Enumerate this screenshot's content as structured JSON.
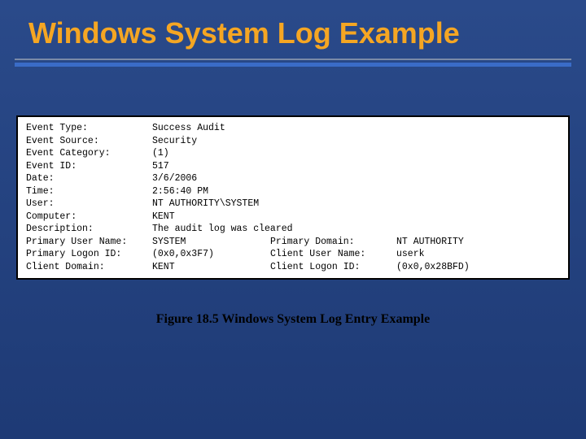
{
  "title": "Windows System Log Example",
  "log": {
    "rows": [
      {
        "label": "Event Type:",
        "value": "Success Audit"
      },
      {
        "label": "Event Source:",
        "value": "Security"
      },
      {
        "label": "Event Category:",
        "value": "(1)"
      },
      {
        "label": "Event ID:",
        "value": "517"
      },
      {
        "label": "Date:",
        "value": "3/6/2006"
      },
      {
        "label": "Time:",
        "value": "2:56:40 PM"
      },
      {
        "label": "User:",
        "value": "NT AUTHORITY\\SYSTEM"
      },
      {
        "label": "Computer:",
        "value": "KENT"
      },
      {
        "label": "Description:",
        "value": "The audit log was cleared"
      }
    ],
    "multi_rows": [
      {
        "l1": "Primary User Name:",
        "v1": "SYSTEM",
        "l2": "Primary Domain:",
        "v2": "NT AUTHORITY"
      },
      {
        "l1": "Primary Logon ID:",
        "v1": "(0x0,0x3F7)",
        "l2": "Client User Name:",
        "v2": "userk"
      },
      {
        "l1": "Client Domain:",
        "v1": "KENT",
        "l2": "Client Logon ID:",
        "v2": "(0x0,0x28BFD)"
      }
    ]
  },
  "caption": "Figure 18.5 Windows System Log Entry Example"
}
